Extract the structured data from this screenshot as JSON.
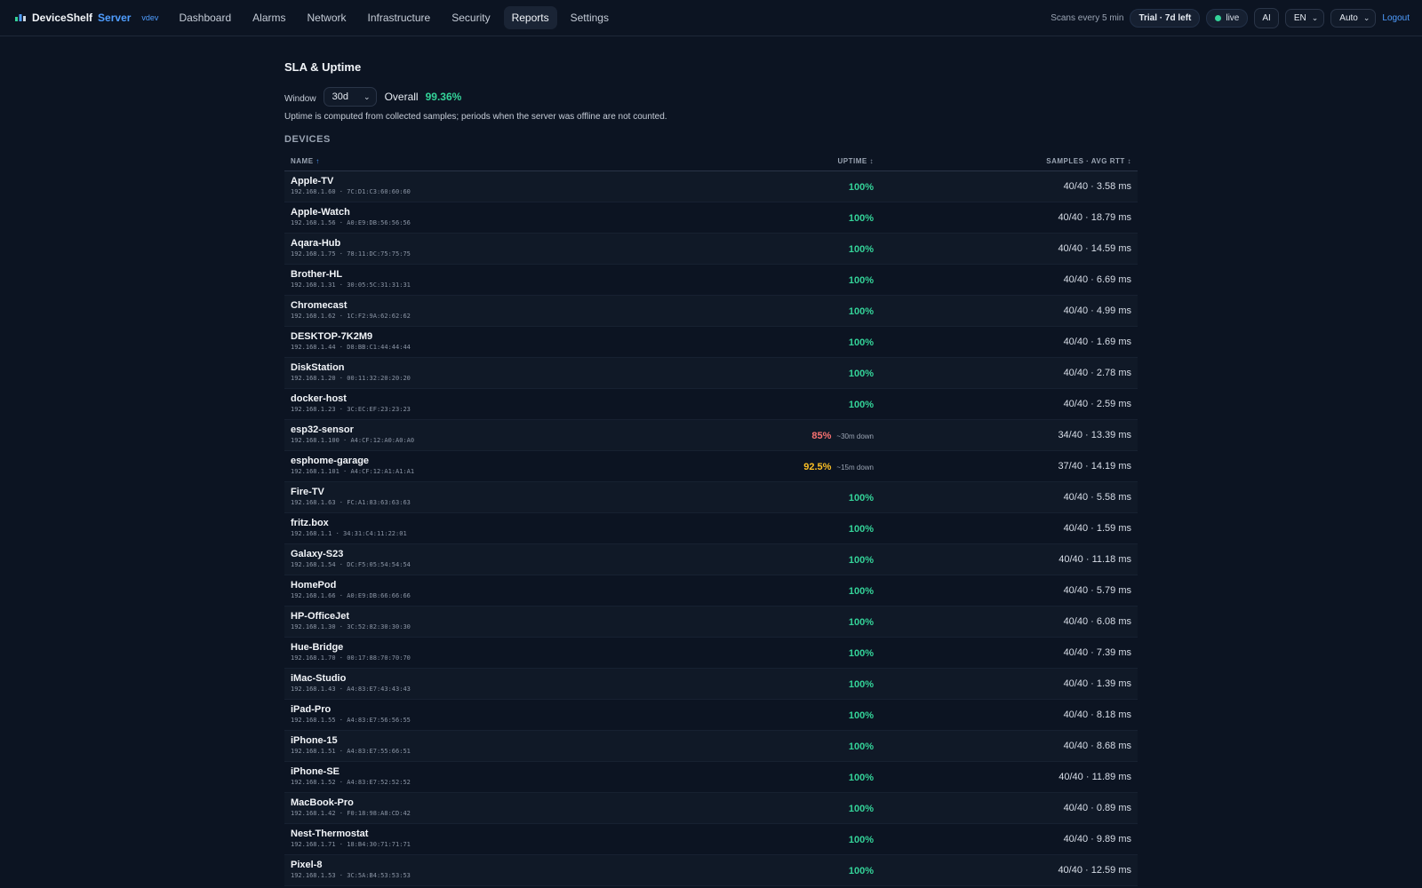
{
  "header": {
    "brand": "DeviceShelf",
    "brand_suffix": "Server",
    "version": "vdev",
    "nav": [
      {
        "label": "Dashboard",
        "active": false
      },
      {
        "label": "Alarms",
        "active": false
      },
      {
        "label": "Network",
        "active": false
      },
      {
        "label": "Infrastructure",
        "active": false
      },
      {
        "label": "Security",
        "active": false
      },
      {
        "label": "Reports",
        "active": true
      },
      {
        "label": "Settings",
        "active": false
      }
    ],
    "scans": "Scans every 5 min",
    "trial": "Trial · 7d left",
    "live": "live",
    "ai": "AI",
    "lang": "EN",
    "theme": "Auto",
    "logout": "Logout"
  },
  "page": {
    "title": "SLA & Uptime",
    "window_label": "Window",
    "window_value": "30d",
    "overall_label": "Overall",
    "overall_value": "99.36%",
    "note": "Uptime is computed from collected samples; periods when the server was offline are not counted.",
    "section": "DEVICES"
  },
  "table": {
    "headers": {
      "name": "NAME",
      "uptime": "UPTIME",
      "samples": "SAMPLES · AVG RTT"
    },
    "rows": [
      {
        "name": "Apple-TV",
        "ip": "192.168.1.60",
        "mac": "7C:D1:C3:60:60:60",
        "uptime": "100%",
        "status": "ok",
        "down": "",
        "samples": "40/40 · 3.58 ms"
      },
      {
        "name": "Apple-Watch",
        "ip": "192.168.1.56",
        "mac": "A0:E9:DB:56:56:56",
        "uptime": "100%",
        "status": "ok",
        "down": "",
        "samples": "40/40 · 18.79 ms"
      },
      {
        "name": "Aqara-Hub",
        "ip": "192.168.1.75",
        "mac": "78:11:DC:75:75:75",
        "uptime": "100%",
        "status": "ok",
        "down": "",
        "samples": "40/40 · 14.59 ms"
      },
      {
        "name": "Brother-HL",
        "ip": "192.168.1.31",
        "mac": "30:05:5C:31:31:31",
        "uptime": "100%",
        "status": "ok",
        "down": "",
        "samples": "40/40 · 6.69 ms"
      },
      {
        "name": "Chromecast",
        "ip": "192.168.1.62",
        "mac": "1C:F2:9A:62:62:62",
        "uptime": "100%",
        "status": "ok",
        "down": "",
        "samples": "40/40 · 4.99 ms"
      },
      {
        "name": "DESKTOP-7K2M9",
        "ip": "192.168.1.44",
        "mac": "D8:BB:C1:44:44:44",
        "uptime": "100%",
        "status": "ok",
        "down": "",
        "samples": "40/40 · 1.69 ms"
      },
      {
        "name": "DiskStation",
        "ip": "192.168.1.20",
        "mac": "00:11:32:20:20:20",
        "uptime": "100%",
        "status": "ok",
        "down": "",
        "samples": "40/40 · 2.78 ms"
      },
      {
        "name": "docker-host",
        "ip": "192.168.1.23",
        "mac": "3C:EC:EF:23:23:23",
        "uptime": "100%",
        "status": "ok",
        "down": "",
        "samples": "40/40 · 2.59 ms"
      },
      {
        "name": "esp32-sensor",
        "ip": "192.168.1.100",
        "mac": "A4:CF:12:A0:A0:A0",
        "uptime": "85%",
        "status": "bad",
        "down": "~30m down",
        "samples": "34/40 · 13.39 ms"
      },
      {
        "name": "esphome-garage",
        "ip": "192.168.1.101",
        "mac": "A4:CF:12:A1:A1:A1",
        "uptime": "92.5%",
        "status": "warn",
        "down": "~15m down",
        "samples": "37/40 · 14.19 ms"
      },
      {
        "name": "Fire-TV",
        "ip": "192.168.1.63",
        "mac": "FC:A1:83:63:63:63",
        "uptime": "100%",
        "status": "ok",
        "down": "",
        "samples": "40/40 · 5.58 ms"
      },
      {
        "name": "fritz.box",
        "ip": "192.168.1.1",
        "mac": "34:31:C4:11:22:01",
        "uptime": "100%",
        "status": "ok",
        "down": "",
        "samples": "40/40 · 1.59 ms"
      },
      {
        "name": "Galaxy-S23",
        "ip": "192.168.1.54",
        "mac": "DC:F5:05:54:54:54",
        "uptime": "100%",
        "status": "ok",
        "down": "",
        "samples": "40/40 · 11.18 ms"
      },
      {
        "name": "HomePod",
        "ip": "192.168.1.66",
        "mac": "A0:E9:DB:66:66:66",
        "uptime": "100%",
        "status": "ok",
        "down": "",
        "samples": "40/40 · 5.79 ms"
      },
      {
        "name": "HP-OfficeJet",
        "ip": "192.168.1.30",
        "mac": "3C:52:82:30:30:30",
        "uptime": "100%",
        "status": "ok",
        "down": "",
        "samples": "40/40 · 6.08 ms"
      },
      {
        "name": "Hue-Bridge",
        "ip": "192.168.1.70",
        "mac": "00:17:88:70:70:70",
        "uptime": "100%",
        "status": "ok",
        "down": "",
        "samples": "40/40 · 7.39 ms"
      },
      {
        "name": "iMac-Studio",
        "ip": "192.168.1.43",
        "mac": "A4:83:E7:43:43:43",
        "uptime": "100%",
        "status": "ok",
        "down": "",
        "samples": "40/40 · 1.39 ms"
      },
      {
        "name": "iPad-Pro",
        "ip": "192.168.1.55",
        "mac": "A4:83:E7:56:56:55",
        "uptime": "100%",
        "status": "ok",
        "down": "",
        "samples": "40/40 · 8.18 ms"
      },
      {
        "name": "iPhone-15",
        "ip": "192.168.1.51",
        "mac": "A4:83:E7:55:66:51",
        "uptime": "100%",
        "status": "ok",
        "down": "",
        "samples": "40/40 · 8.68 ms"
      },
      {
        "name": "iPhone-SE",
        "ip": "192.168.1.52",
        "mac": "A4:83:E7:52:52:52",
        "uptime": "100%",
        "status": "ok",
        "down": "",
        "samples": "40/40 · 11.89 ms"
      },
      {
        "name": "MacBook-Pro",
        "ip": "192.168.1.42",
        "mac": "F0:18:98:A8:CD:42",
        "uptime": "100%",
        "status": "ok",
        "down": "",
        "samples": "40/40 · 0.89 ms"
      },
      {
        "name": "Nest-Thermostat",
        "ip": "192.168.1.71",
        "mac": "18:B4:30:71:71:71",
        "uptime": "100%",
        "status": "ok",
        "down": "",
        "samples": "40/40 · 9.89 ms"
      },
      {
        "name": "Pixel-8",
        "ip": "192.168.1.53",
        "mac": "3C:5A:B4:53:53:53",
        "uptime": "100%",
        "status": "ok",
        "down": "",
        "samples": "40/40 · 12.59 ms"
      }
    ]
  }
}
